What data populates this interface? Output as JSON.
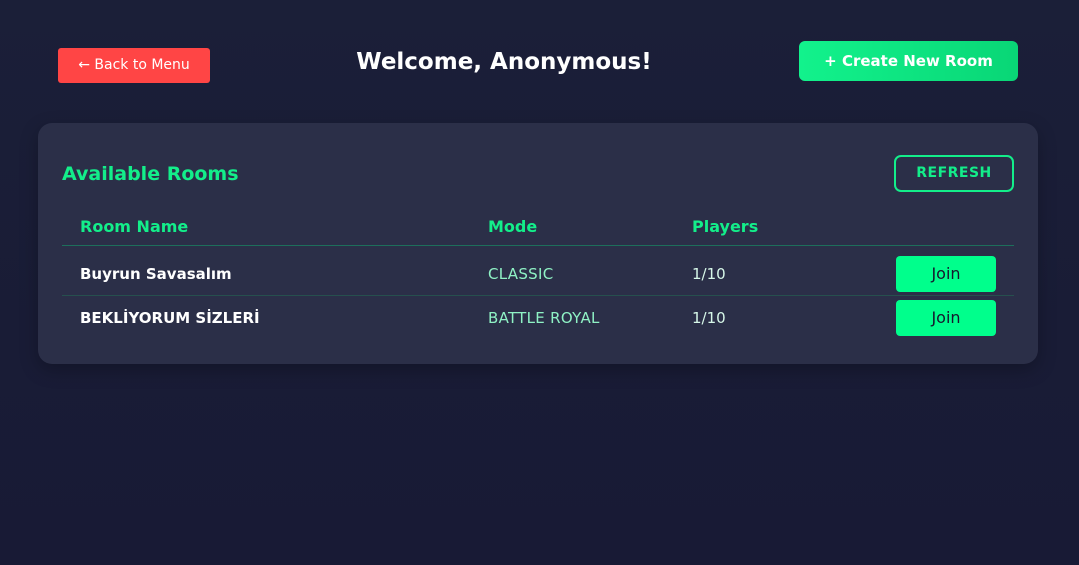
{
  "header": {
    "back_label": "← Back to Menu",
    "welcome_text": "Welcome, Anonymous!",
    "create_label": "+ Create New Room"
  },
  "rooms_panel": {
    "title": "Available Rooms",
    "refresh_label": "REFRESH",
    "columns": {
      "name": "Room Name",
      "mode": "Mode",
      "players": "Players"
    },
    "rooms": [
      {
        "name": "Buyrun Savasalım",
        "mode": "CLASSIC",
        "players": "1/10",
        "join_label": "Join"
      },
      {
        "name": "BEKLİYORUM SİZLERİ",
        "mode": "BATTLE ROYAL",
        "players": "1/10",
        "join_label": "Join"
      }
    ]
  },
  "colors": {
    "accent": "#13ee8a",
    "danger": "#ff4545",
    "background": "#1a1d37",
    "panel": "#2b2f48"
  }
}
